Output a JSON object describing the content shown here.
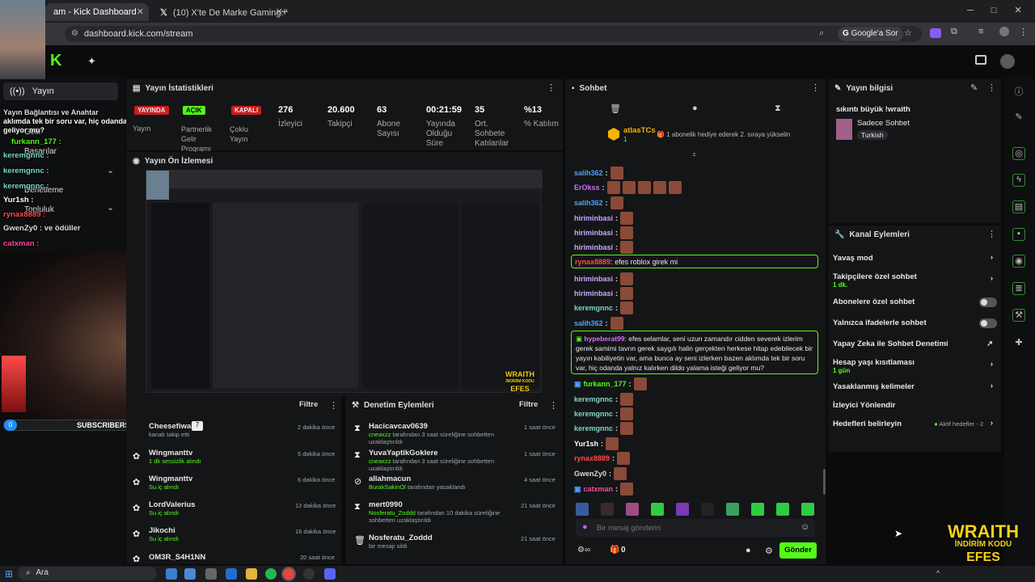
{
  "browser": {
    "tabs": [
      {
        "label": "am - Kick Dashboard"
      },
      {
        "label": "(10) X'te De Marke Gaming: \"Er"
      }
    ],
    "url": "dashboard.kick.com/stream",
    "google_ask": "Google'a Sor"
  },
  "sidebar": {
    "active": "Yayın",
    "items": [
      "Gelir",
      "Başarılar",
      "Denetleme",
      "Topluluk"
    ]
  },
  "overlay_chat": [
    {
      "user": "",
      "text": "aklımda tek bir soru var, hiç odanda yalnız kalırken dildo yalama isteği geliyor mu?"
    },
    {
      "user": "furkann_177 :",
      "text": ""
    },
    {
      "user": "keremgnnc :",
      "text": ""
    },
    {
      "user": "keremgnnc :",
      "text": ""
    },
    {
      "user": "keremgnnc :",
      "text": ""
    },
    {
      "user": "Yur1sh :",
      "text": ""
    },
    {
      "user": "rynax8889 :",
      "text": ""
    },
    {
      "user": "GwenZy0 :",
      "text": ""
    },
    {
      "user": "catxman :",
      "text": ""
    }
  ],
  "overlay_extra": {
    "line1": "Yayın Bağlantısı ve Anahtar",
    "line2": "ve ödüller"
  },
  "subscribers": {
    "count": "0",
    "label": "SUBSCRIBERS"
  },
  "stats": {
    "title": "Yayın İstatistikleri",
    "badges": [
      "YAYINDA",
      "AÇIK",
      "KAPALI"
    ],
    "badge_labels": [
      "Yayın",
      "Partnerlik Gelir Programı",
      "Çoklu Yayın"
    ],
    "items": [
      {
        "value": "276",
        "label": "İzleyici"
      },
      {
        "value": "20.600",
        "label": "Takipçi"
      },
      {
        "value": "63",
        "label": "Abone Sayısı"
      },
      {
        "value": "00:21:59",
        "label": "Yayında Olduğu Süre"
      },
      {
        "value": "35",
        "label": "Ort. Sohbete Katılanlar"
      },
      {
        "value": "%13",
        "label": "% Katılım"
      }
    ]
  },
  "preview": {
    "title": "Yayın Ön İzlemesi",
    "brand": "WRAITH",
    "promo": "İNDİRİM KODU",
    "code": "EFES"
  },
  "activity": {
    "filter": "Filtre",
    "rows": [
      {
        "user": "Cheesefiwai",
        "detail": "kanalı takip etti",
        "time": "2 dakika önce"
      },
      {
        "user": "Wingmanttv",
        "detail": "1 dk sessizlik alındı",
        "time": "5 dakika önce"
      },
      {
        "user": "Wingmanttv",
        "detail": "Su iç alındı",
        "time": "6 dakika önce"
      },
      {
        "user": "LordValerius",
        "detail": "Su iç alındı",
        "time": "12 dakika önce"
      },
      {
        "user": "Jikochi",
        "detail": "Su iç alındı",
        "time": "16 dakika önce"
      },
      {
        "user": "OM3R_S4H1NN",
        "detail": "",
        "time": "20 saat önce"
      }
    ]
  },
  "moderation": {
    "title": "Denetim Eylemleri",
    "filter": "Filtre",
    "rows": [
      {
        "user": "Hacicavcav0639",
        "actor": "cneaxzz",
        "detail": "tarafından 3 saat süreliğine sohbetten uzaklaştırıldı",
        "time": "1 saat önce"
      },
      {
        "user": "YuvaYaptikGoklere",
        "actor": "cneaxzz",
        "detail": "tarafından 3 saat süreliğine sohbetten uzaklaştırıldı",
        "time": "1 saat önce"
      },
      {
        "user": "allahmacun",
        "actor": "BurakSakinOl",
        "detail": "tarafından yasaklandı",
        "time": "4 saat önce"
      },
      {
        "user": "mert0990",
        "actor": "Nosferatu_Zoddd",
        "detail": "tarafından 10 dakika süreliğine sohbetten uzaklaştırıldı",
        "time": "21 saat önce"
      },
      {
        "user": "Nosferatu_Zoddd",
        "actor": "",
        "detail": "bir mesajı sildi",
        "time": "21 saat önce"
      }
    ]
  },
  "chat": {
    "title": "Sohbet",
    "gifter": "atlasTCs",
    "gifter_count": "1",
    "gift_text": "1 abonelik hediye ederek 2. sıraya yükselin",
    "messages": [
      {
        "user": "salih362",
        "color": "#4aa3ff",
        "text": ""
      },
      {
        "user": "ErOkss",
        "color": "#d86bff",
        "text": ""
      },
      {
        "user": "salih362",
        "color": "#4aa3ff",
        "text": ""
      },
      {
        "user": "hiriminbasi",
        "color": "#c9a6ff",
        "text": ""
      },
      {
        "user": "hiriminbasi",
        "color": "#c9a6ff",
        "text": ""
      },
      {
        "user": "hiriminbasi",
        "color": "#c9a6ff",
        "text": ""
      },
      {
        "user": "rynax8889",
        "color": "#ff4a4a",
        "text": "efes roblox girek mi"
      },
      {
        "user": "hiriminbasi",
        "color": "#c9a6ff",
        "text": ""
      },
      {
        "user": "hiriminbasi",
        "color": "#c9a6ff",
        "text": ""
      },
      {
        "user": "keremgnnc",
        "color": "#7fd6c4",
        "text": ""
      },
      {
        "user": "salih362",
        "color": "#4aa3ff",
        "text": ""
      }
    ],
    "highlight": {
      "user": "hypeberat99",
      "color": "#d86bff",
      "text": "efes selamlar, seni uzun zamandır cidden severek izlerim gerek samimi tavrın gerek saygılı halin gerçekten herkese hitap edebilecek bir yayın kabiliyetin var, ama bunca ay seni izlerken bazen aklımda tek bir soru var, hiç odanda yalnız kalırken dildo yalama isteği geliyor mu?"
    },
    "messages2": [
      {
        "user": "furkann_177",
        "color": "#53fc18",
        "text": ""
      },
      {
        "user": "keremgnnc",
        "color": "#7fd6c4",
        "text": ""
      },
      {
        "user": "keremgnnc",
        "color": "#7fd6c4",
        "text": ""
      },
      {
        "user": "keremgnnc",
        "color": "#7fd6c4",
        "text": ""
      },
      {
        "user": "Yur1sh",
        "color": "#ffffff",
        "text": ""
      },
      {
        "user": "rynax8889",
        "color": "#ff4a4a",
        "text": ""
      },
      {
        "user": "GwenZy0",
        "color": "#d8d8d8",
        "text": ""
      },
      {
        "user": "catxman",
        "color": "#ff4a9a",
        "text": ""
      }
    ],
    "placeholder": "Bir mesaj gönderin",
    "count": "0",
    "send": "Gönder"
  },
  "stream_info": {
    "title": "Yayın bilgisi",
    "stream_title": "sıkıntı büyük !wraith",
    "category": "Sadece Sohbet",
    "tag": "Turkish"
  },
  "channel_actions": {
    "title": "Kanal Eylemleri",
    "items": [
      {
        "label": "Yavaş mod",
        "sub": "",
        "control": "arrow"
      },
      {
        "label": "Takipçilere özel sohbet",
        "sub": "1 dk.",
        "control": "arrow"
      },
      {
        "label": "Abonelere özel sohbet",
        "sub": "",
        "control": "toggle"
      },
      {
        "label": "Yalnızca ifadelerle sohbet",
        "sub": "",
        "control": "toggle"
      },
      {
        "label": "Yapay Zeka ile Sohbet Denetimi",
        "sub": "",
        "control": "external"
      },
      {
        "label": "Hesap yaşı kısıtlaması",
        "sub": "1 gün",
        "control": "arrow"
      },
      {
        "label": "Yasaklanmış kelimeler",
        "sub": "",
        "control": "arrow"
      },
      {
        "label": "İzleyici Yönlendir",
        "sub": "",
        "control": ""
      },
      {
        "label": "Hedefleri belirleyin",
        "sub": "Aktif hedefler - 2",
        "control": "arrow"
      }
    ]
  },
  "brand_overlay": {
    "brand": "WRAITH",
    "promo": "İNDİRİM KODU",
    "code": "EFES"
  },
  "taskbar": {
    "search": "Ara"
  }
}
